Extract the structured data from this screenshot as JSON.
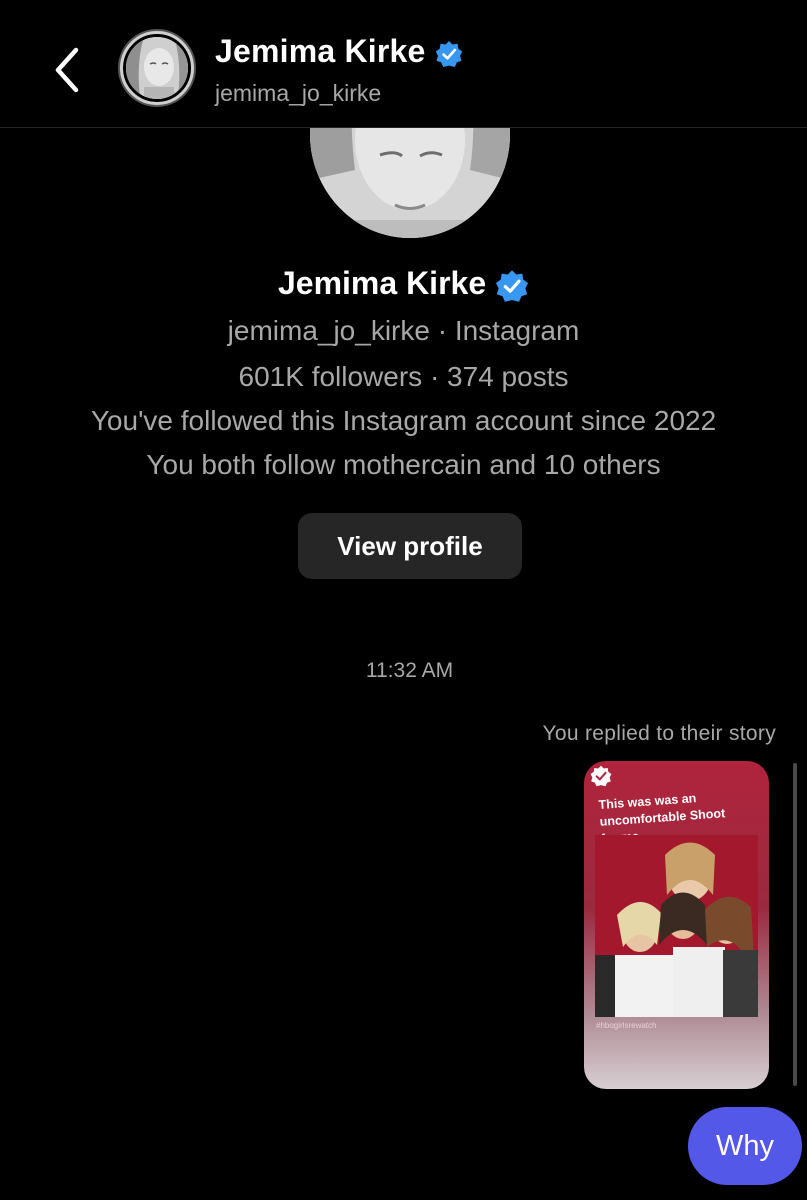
{
  "header": {
    "name": "Jemima Kirke",
    "username": "jemima_jo_kirke"
  },
  "profile": {
    "name": "Jemima Kirke",
    "handle_line": "jemima_jo_kirke · Instagram",
    "stats_line": "601K followers · 374 posts",
    "followed_line": "You've followed this Instagram account since 2022",
    "mutual_line": "You both follow mothercain and 10 others",
    "view_profile_label": "View profile"
  },
  "conversation": {
    "timestamp": "11:32 AM",
    "story_reply_label": "You replied to their story",
    "story_caption": "This was was an uncomfortable Shoot for me",
    "message": "Why"
  },
  "colors": {
    "background": "#000000",
    "verified_badge": "#3897f0",
    "message_bubble": "#5458e8",
    "secondary_text": "#a8a8a8",
    "button": "#262626"
  },
  "icons": [
    "chevron-left-icon",
    "verified-badge-icon"
  ]
}
